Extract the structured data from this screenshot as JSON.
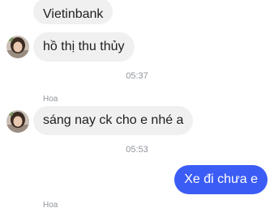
{
  "messages": [
    {
      "sender": "",
      "text": "Vietinbank",
      "direction": "incoming"
    },
    {
      "sender": "",
      "text": "hồ thị thu thủy",
      "direction": "incoming"
    },
    {
      "timestamp": "05:37"
    },
    {
      "sender": "Hoa",
      "text": "sáng nay ck cho e nhé a",
      "direction": "incoming"
    },
    {
      "timestamp": "05:53"
    },
    {
      "sender": "",
      "text": "Xe đi chưa e",
      "direction": "outgoing"
    },
    {
      "sender": "Hoa",
      "text": "",
      "direction": "incoming"
    }
  ],
  "colors": {
    "incoming_bubble": "#f1f0f0",
    "outgoing_bubble": "#3b5cf5",
    "meta_text": "#90949c"
  },
  "icons": {
    "contact_avatar": "avatar-icon"
  }
}
